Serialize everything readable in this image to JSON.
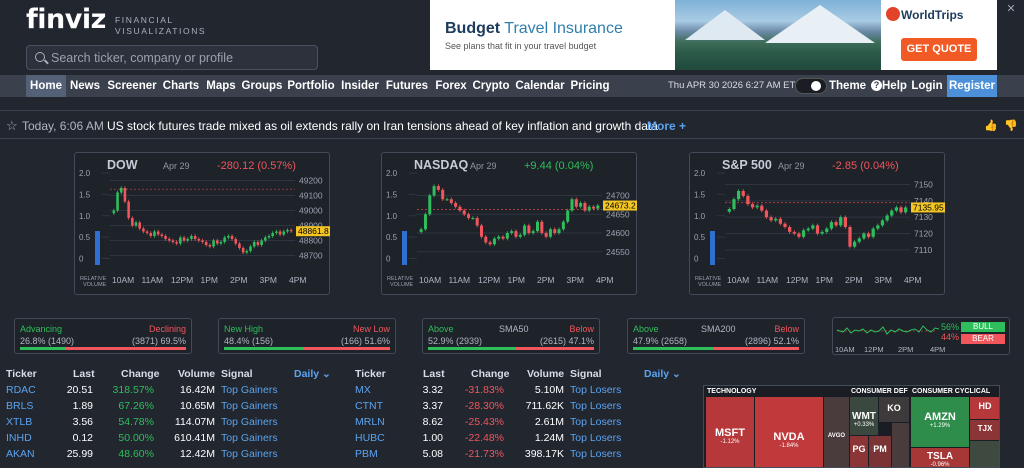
{
  "header": {
    "logo": "finviz",
    "logo_sub_1": "FINANCIAL",
    "logo_sub_2": "VISUALIZATIONS",
    "search_placeholder": "Search ticker, company or profile"
  },
  "ad": {
    "title_bold": "Budget",
    "title_rest": " Travel Insurance",
    "subtitle": "See plans that fit in your travel budget",
    "brand": "WorldTrips",
    "cta": "GET QUOTE",
    "close": "✕"
  },
  "nav": {
    "items": [
      "Home",
      "News",
      "Screener",
      "Charts",
      "Maps",
      "Groups",
      "Portfolio",
      "Insider",
      "Futures",
      "Forex",
      "Crypto",
      "Calendar",
      "Pricing"
    ],
    "datetime": "Thu APR 30 2026 6:27 AM ET",
    "theme": "Theme",
    "help": "Help",
    "login": "Login",
    "register": "Register"
  },
  "news": {
    "time": "Today, 6:06 AM",
    "headline": "US stock futures trade mixed as oil extends rally on Iran tensions ahead of key inflation and growth data",
    "more": "More +"
  },
  "charts": [
    {
      "name": "DOW",
      "date": "Apr 29",
      "change": "-280.12 (0.57%)",
      "change_color": "#f0565c",
      "yticks": [
        "49200",
        "49100",
        "49000",
        "48900",
        "48800",
        "48700"
      ],
      "ymin": 48650,
      "ymax": 49250,
      "last": "48861.8",
      "last_val": 48861.8,
      "prevclose": 49142,
      "x": [
        "10AM",
        "11AM",
        "12PM",
        "1PM",
        "2PM",
        "3PM",
        "4PM"
      ],
      "closes": [
        49000,
        49120,
        49150,
        49060,
        48950,
        48900,
        48920,
        48880,
        48860,
        48850,
        48830,
        48860,
        48840,
        48830,
        48810,
        48800,
        48790,
        48780,
        48820,
        48800,
        48810,
        48830,
        48810,
        48800,
        48790,
        48770,
        48760,
        48800,
        48780,
        48790,
        48820,
        48830,
        48810,
        48780,
        48750,
        48720,
        48730,
        48760,
        48790,
        48770,
        48800,
        48820,
        48830,
        48850,
        48860,
        48840,
        48860,
        48870,
        48861.8
      ]
    },
    {
      "name": "NASDAQ",
      "date": "Apr 29",
      "change": "+9.44 (0.04%)",
      "change_color": "#2fbe5c",
      "yticks": [
        "24700",
        "24650",
        "24600",
        "24550"
      ],
      "ymin": 24520,
      "ymax": 24760,
      "last": "24673.2",
      "last_val": 24673.2,
      "prevclose": 24663,
      "x": [
        "10AM",
        "11AM",
        "12PM",
        "1PM",
        "2PM",
        "3PM",
        "4PM"
      ],
      "closes": [
        24610,
        24650,
        24700,
        24725,
        24715,
        24690,
        24690,
        24680,
        24670,
        24660,
        24650,
        24640,
        24640,
        24620,
        24590,
        24575,
        24570,
        24585,
        24590,
        24585,
        24600,
        24605,
        24590,
        24595,
        24620,
        24600,
        24605,
        24630,
        24600,
        24590,
        24610,
        24600,
        24610,
        24630,
        24660,
        24690,
        24670,
        24680,
        24660,
        24670,
        24665,
        24673.2
      ]
    },
    {
      "name": "S&P 500",
      "date": "Apr 29",
      "change": "-2.85 (0.04%)",
      "change_color": "#f0565c",
      "yticks": [
        "7150",
        "7140",
        "7130",
        "7120",
        "7110"
      ],
      "ymin": 7102,
      "ymax": 7157,
      "last": "7135.95",
      "last_val": 7135.95,
      "prevclose": 7138.8,
      "x": [
        "10AM",
        "11AM",
        "12PM",
        "1PM",
        "2PM",
        "3PM",
        "4PM"
      ],
      "closes": [
        7135,
        7141,
        7146,
        7143,
        7138,
        7136,
        7137,
        7134,
        7130,
        7128,
        7129,
        7126,
        7124,
        7121,
        7120,
        7118,
        7122,
        7123,
        7125,
        7120,
        7121,
        7123,
        7127,
        7125,
        7130,
        7124,
        7112,
        7115,
        7117,
        7120,
        7118,
        7123,
        7125,
        7128,
        7131,
        7134,
        7136,
        7133,
        7135.95
      ]
    }
  ],
  "volume_label": [
    "RELATIVE",
    "VOLUME"
  ],
  "volume_yticks": [
    "2.0",
    "1.5",
    "1.0",
    "0.5",
    "0"
  ],
  "breadth": [
    {
      "left_label": "Advancing",
      "right_label": "Declining",
      "mid": "",
      "left_val": "26.8% (1490)",
      "right_val": "(3871) 69.5%",
      "fill": 0.278
    },
    {
      "left_label": "New High",
      "right_label": "New Low",
      "mid": "",
      "left_val": "48.4% (156)",
      "right_val": "(166) 51.6%",
      "fill": 0.484
    },
    {
      "left_label": "Above",
      "right_label": "Below",
      "mid": "SMA50",
      "left_val": "52.9% (2939)",
      "right_val": "(2615) 47.1%",
      "fill": 0.529
    },
    {
      "left_label": "Above",
      "right_label": "Below",
      "mid": "SMA200",
      "left_val": "47.9% (2658)",
      "right_val": "(2896) 52.1%",
      "fill": 0.479
    }
  ],
  "sentiment": {
    "bull_pct": "56%",
    "bear_pct": "44%",
    "bull": "BULL",
    "bear": "BEAR",
    "x": [
      "10AM",
      "12PM",
      "2PM",
      "4PM"
    ]
  },
  "table_headers": [
    "Ticker",
    "Last",
    "Change",
    "Volume",
    "Signal"
  ],
  "period": "Daily",
  "gainers": [
    [
      "RDAC",
      "20.51",
      "318.57%",
      "16.42M",
      "Top Gainers"
    ],
    [
      "BRLS",
      "1.89",
      "67.26%",
      "10.65M",
      "Top Gainers"
    ],
    [
      "XTLB",
      "3.56",
      "54.78%",
      "114.07M",
      "Top Gainers"
    ],
    [
      "INHD",
      "0.12",
      "50.00%",
      "610.41M",
      "Top Gainers"
    ],
    [
      "AKAN",
      "25.99",
      "48.60%",
      "12.42M",
      "Top Gainers"
    ]
  ],
  "losers": [
    [
      "MX",
      "3.32",
      "-31.83%",
      "5.10M",
      "Top Losers"
    ],
    [
      "CTNT",
      "3.37",
      "-28.30%",
      "711.62K",
      "Top Losers"
    ],
    [
      "MRLN",
      "8.62",
      "-25.43%",
      "2.61M",
      "Top Losers"
    ],
    [
      "HUBC",
      "1.00",
      "-22.48%",
      "1.24M",
      "Top Losers"
    ],
    [
      "PBM",
      "5.08",
      "-21.73%",
      "398.17K",
      "Top Losers"
    ]
  ],
  "map": {
    "sectors": [
      "TECHNOLOGY",
      "CONSUMER DEF",
      "CONSUMER CYCLICAL"
    ],
    "tiles": [
      {
        "t": "MSFT",
        "c": "-1.12%"
      },
      {
        "t": "NVDA",
        "c": "-1.84%"
      },
      {
        "t": "AVGO",
        "c": ""
      },
      {
        "t": "WMT",
        "c": "+0.33%"
      },
      {
        "t": "KO",
        "c": ""
      },
      {
        "t": "PG",
        "c": ""
      },
      {
        "t": "PM",
        "c": ""
      },
      {
        "t": "AMZN",
        "c": "+1.29%"
      },
      {
        "t": "TSLA",
        "c": "-0.96%"
      },
      {
        "t": "HD",
        "c": ""
      },
      {
        "t": "TJX",
        "c": ""
      }
    ]
  }
}
